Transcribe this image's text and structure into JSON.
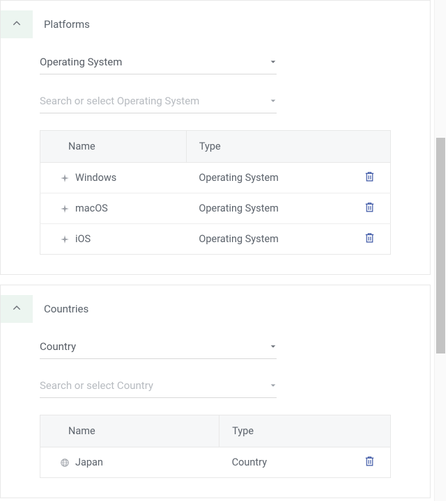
{
  "panels": [
    {
      "id": "platforms",
      "title": "Platforms",
      "select_type_label": "Operating System",
      "search_placeholder": "Search or select Operating System",
      "columns": {
        "name": "Name",
        "type": "Type"
      },
      "rows": [
        {
          "icon": "sparkle",
          "name": "Windows",
          "type": "Operating System"
        },
        {
          "icon": "sparkle",
          "name": "macOS",
          "type": "Operating System"
        },
        {
          "icon": "sparkle",
          "name": "iOS",
          "type": "Operating System"
        }
      ]
    },
    {
      "id": "countries",
      "title": "Countries",
      "select_type_label": "Country",
      "search_placeholder": "Search or select Country",
      "columns": {
        "name": "Name",
        "type": "Type"
      },
      "rows": [
        {
          "icon": "globe",
          "name": "Japan",
          "type": "Country"
        }
      ]
    }
  ]
}
